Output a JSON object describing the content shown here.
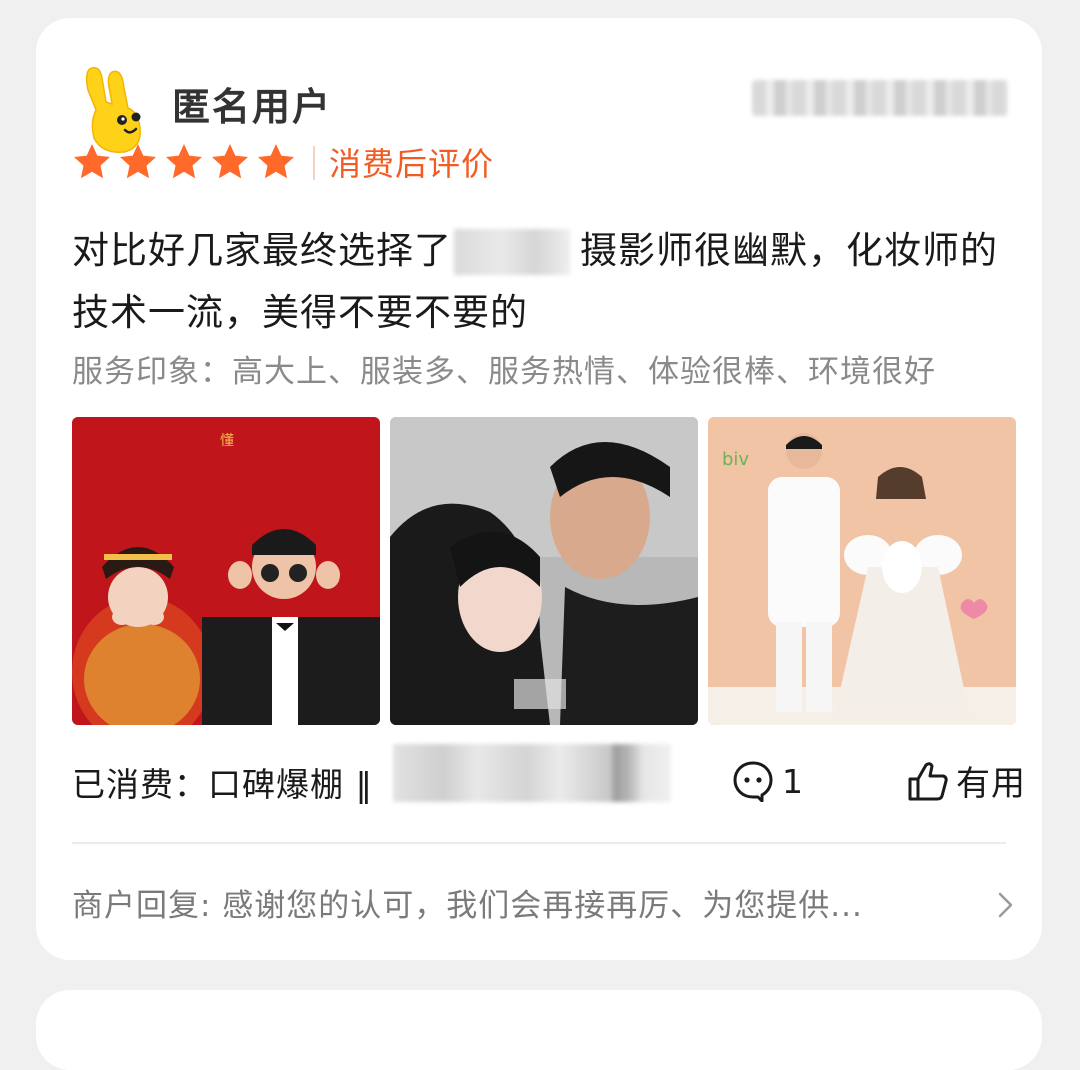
{
  "review": {
    "username": "匿名用户",
    "rating": 5,
    "rating_max": 5,
    "consume_tag": "消费后评价",
    "text_before": "对比好几家最终选择了",
    "text_after": "摄影师很幽默，化妆师的技术一流，美得不要不要的",
    "impression": "服务印象：高大上、服装多、服务热情、体验很棒、环境很好",
    "photos": [
      {
        "name": "traditional-wedding-photo"
      },
      {
        "name": "couple-kiss-photo"
      },
      {
        "name": "white-outfit-couple-photo"
      }
    ],
    "consumed_label": "已消费：口碑爆棚 ‖",
    "comment_count": "1",
    "useful_label": "有用",
    "merchant_reply": "商户回复: 感谢您的认可，我们会再接再厉、为您提供..."
  },
  "colors": {
    "accent": "#f25c22",
    "star": "#ff6a2b",
    "page_bg": "#f0f0f0",
    "card_bg": "#ffffff"
  },
  "icons": {
    "avatar": "yellow-mascot-avatar",
    "star": "star-icon",
    "comment": "comment-icon",
    "like": "thumbs-up-icon",
    "chevron": "chevron-right-icon"
  }
}
